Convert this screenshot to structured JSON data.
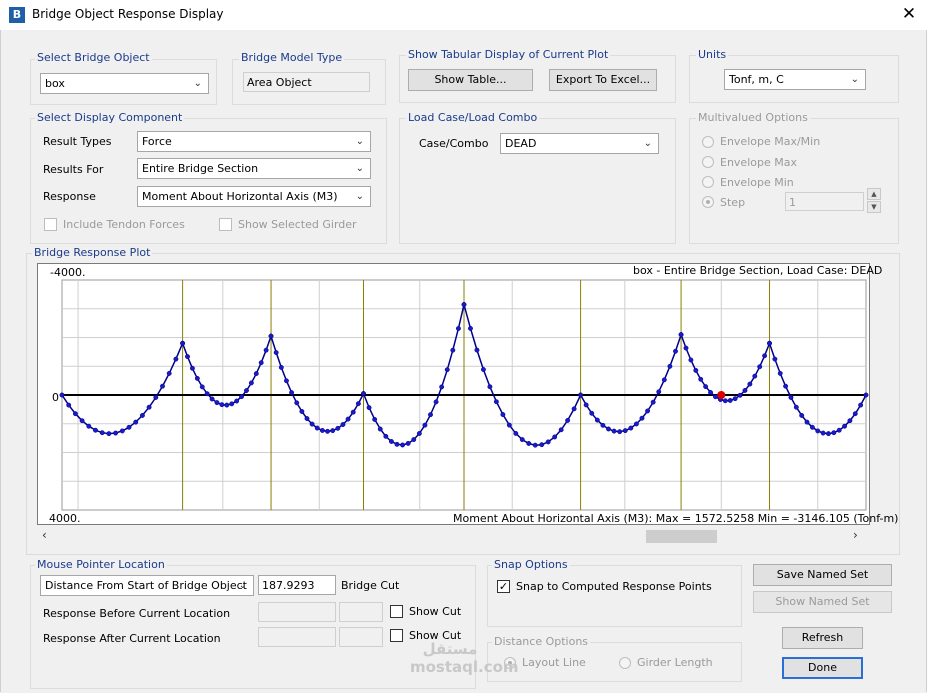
{
  "window": {
    "title": "Bridge Object Response Display",
    "icon_letter": "B",
    "close_glyph": "✕"
  },
  "select_bridge_object": {
    "label": "Select Bridge Object",
    "value": "box"
  },
  "bridge_model_type": {
    "label": "Bridge Model Type",
    "value": "Area Object"
  },
  "tabular": {
    "label": "Show Tabular Display of Current Plot",
    "show_table": "Show Table...",
    "export_excel": "Export To Excel..."
  },
  "units": {
    "label": "Units",
    "value": "Tonf, m, C"
  },
  "display_component": {
    "label": "Select Display Component",
    "result_types_label": "Result Types",
    "result_types_value": "Force",
    "results_for_label": "Results For",
    "results_for_value": "Entire Bridge Section",
    "response_label": "Response",
    "response_value": "Moment About Horizontal Axis  (M3)",
    "include_tendon": "Include Tendon Forces",
    "show_girder": "Show Selected Girder"
  },
  "load_case": {
    "label": "Load Case/Load Combo",
    "case_label": "Case/Combo",
    "case_value": "DEAD"
  },
  "multivalued": {
    "label": "Multivalued Options",
    "envelope_maxmin": "Envelope Max/Min",
    "envelope_max": "Envelope Max",
    "envelope_min": "Envelope Min",
    "step": "Step",
    "step_value": "1"
  },
  "plot": {
    "group_label": "Bridge Response Plot",
    "top_value": "-4000.",
    "zero_value": "0",
    "bottom_value": "4000.",
    "header": "box - Entire Bridge Section,  Load Case: DEAD",
    "footer": "Moment About Horizontal Axis  (M3):  Max = 1572.5258    Min = -3146.105  (Tonf-m)",
    "scroll_left": "‹",
    "scroll_right": "›"
  },
  "chart_data": {
    "type": "line",
    "xlim": [
      0,
      1000
    ],
    "ylim": [
      4000,
      -4000
    ],
    "grid": true,
    "support_lines_x": [
      150,
      260,
      375,
      500,
      645,
      770,
      880
    ],
    "extra_gridlines_x": [
      20,
      200,
      320,
      445,
      560,
      700,
      820,
      940
    ],
    "spans": [
      {
        "x0": 0,
        "x1": 150,
        "peak_value": 1250,
        "start_value": 0,
        "end_value": -1800
      },
      {
        "x0": 150,
        "x1": 260,
        "peak_value": 350,
        "start_value": -1800,
        "end_value": -2050
      },
      {
        "x0": 260,
        "x1": 375,
        "peak_value": 1150,
        "start_value": -2050,
        "end_value": -50
      },
      {
        "x0": 375,
        "x1": 500,
        "peak_value": 1550,
        "start_value": -50,
        "end_value": -3146
      },
      {
        "x0": 500,
        "x1": 645,
        "peak_value": 1550,
        "start_value": -3146,
        "end_value": 0
      },
      {
        "x0": 645,
        "x1": 770,
        "peak_value": 1150,
        "start_value": 0,
        "end_value": -2100
      },
      {
        "x0": 770,
        "x1": 880,
        "peak_value": 200,
        "start_value": -2100,
        "end_value": -1800
      },
      {
        "x0": 880,
        "x1": 1000,
        "peak_value": 1250,
        "start_value": -1800,
        "end_value": 0
      }
    ],
    "cursor_point": {
      "x": 820,
      "y": 0
    },
    "line_color": "#00008b",
    "cursor_color": "#e00000",
    "support_color": "#8b8000"
  },
  "mouse_pointer": {
    "label": "Mouse Pointer Location",
    "mode": "Distance From Start of Bridge Object",
    "distance": "187.9293",
    "bridge_cut": "Bridge Cut",
    "before_label": "Response Before Current Location",
    "after_label": "Response After Current Location",
    "show_cut": "Show Cut"
  },
  "snap": {
    "label": "Snap Options",
    "snap_label": "Snap to Computed Response Points"
  },
  "distance_options": {
    "label": "Distance Options",
    "layout_line": "Layout Line",
    "girder_length": "Girder Length"
  },
  "buttons": {
    "save_named_set": "Save Named Set",
    "show_named_set": "Show Named Set",
    "refresh": "Refresh",
    "done": "Done"
  },
  "watermark": "مستقل mostaql.com"
}
